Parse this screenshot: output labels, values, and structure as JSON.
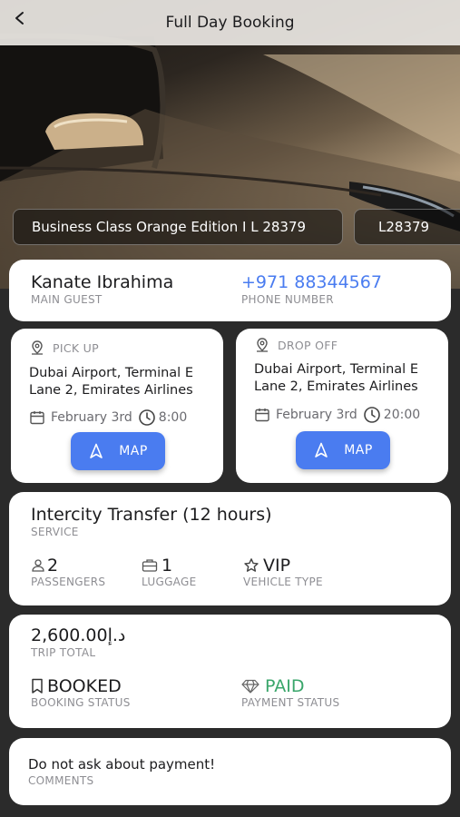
{
  "header": {
    "title": "Full Day Booking"
  },
  "vehicle_chips": [
    {
      "label": "Business Class Orange Edition I L 28379"
    },
    {
      "label": "L28379"
    }
  ],
  "guest": {
    "name": "Kanate Ibrahima",
    "name_caption": "MAIN GUEST",
    "phone": "+971 88344567",
    "phone_caption": "PHONE NUMBER"
  },
  "pickup": {
    "label": "PICK UP",
    "address_line1": "Dubai Airport, Terminal E",
    "address_line2": "Lane 2, Emirates Airlines",
    "date": "February 3rd",
    "time": "8:00",
    "map_label": "MAP"
  },
  "dropoff": {
    "label": "DROP OFF",
    "address_line1": "Dubai Airport, Terminal E",
    "address_line2": "Lane 2, Emirates Airlines",
    "date": "February 3rd",
    "time": "20:00",
    "map_label": "MAP"
  },
  "service": {
    "title": "Intercity Transfer (12 hours)",
    "caption": "SERVICE",
    "passengers_value": "2",
    "passengers_caption": "PASSENGERS",
    "luggage_value": "1",
    "luggage_caption": "LUGGAGE",
    "vehicle_type_value": "VIP",
    "vehicle_type_caption": "VEHICLE TYPE"
  },
  "trip": {
    "total": "2,600.00د.إ",
    "total_caption": "TRIP TOTAL",
    "booking_status": "BOOKED",
    "booking_status_caption": "BOOKING STATUS",
    "payment_status": "PAID",
    "payment_status_caption": "PAYMENT STATUS"
  },
  "comments": {
    "text": "Do not ask about payment!",
    "caption": "COMMENTS"
  },
  "colors": {
    "accent_blue": "#4a7cf0",
    "paid_green": "#3aa66b",
    "background_dark": "#2b2b2b"
  },
  "icons": [
    "back-arrow-icon",
    "location-pin-icon",
    "calendar-icon",
    "clock-icon",
    "navigation-arrow-icon",
    "person-icon",
    "luggage-icon",
    "star-icon",
    "bookmark-icon",
    "diamond-icon"
  ]
}
